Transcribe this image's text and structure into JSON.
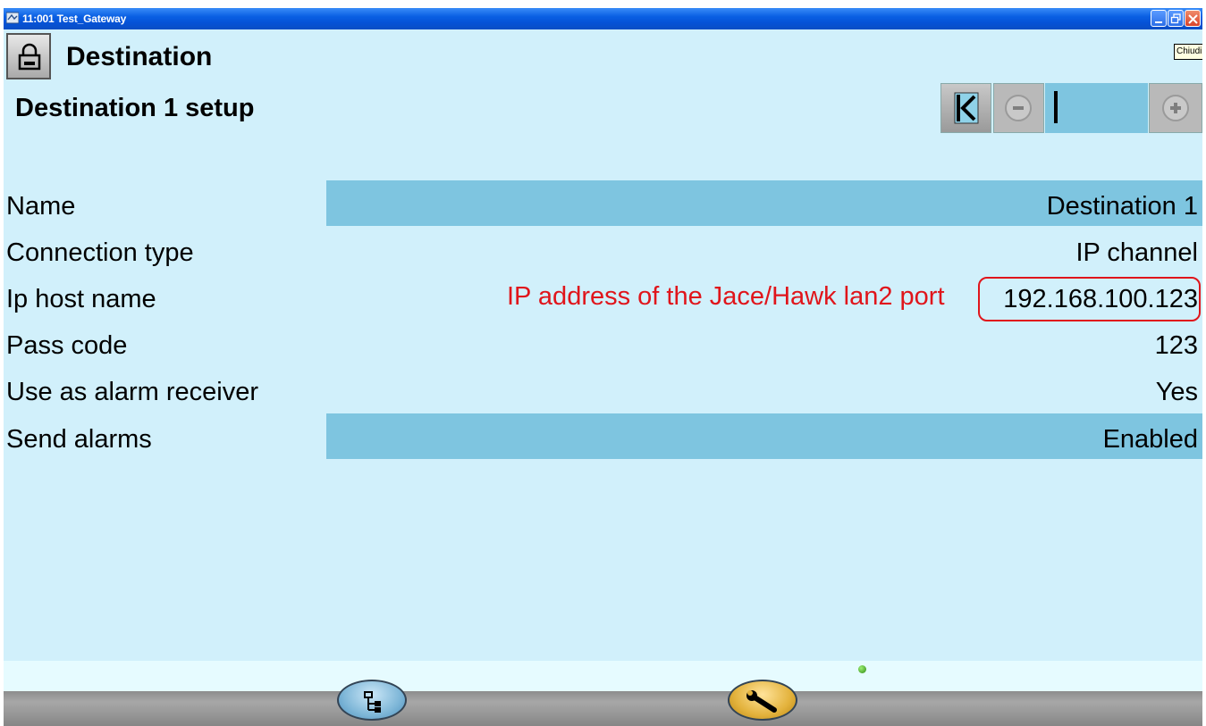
{
  "window": {
    "title": "11:001 Test_Gateway",
    "tooltip": "Chiudi"
  },
  "header": {
    "title": "Destination",
    "subtitle": "Destination 1 setup"
  },
  "rows": [
    {
      "label": "Name",
      "value": "Destination 1"
    },
    {
      "label": "Connection type",
      "value": "IP channel"
    },
    {
      "label": "Ip host name",
      "value": "192.168.100.123"
    },
    {
      "label": "Pass code",
      "value": "123"
    },
    {
      "label": "Use as alarm receiver",
      "value": "Yes"
    },
    {
      "label": "Send alarms",
      "value": "Enabled"
    }
  ],
  "annotation": "IP address of the Jace/Hawk lan2 port",
  "icons": {
    "lock": "lock-icon",
    "first": "first-page-icon",
    "prev": "minus-icon",
    "next": "plus-icon",
    "tree": "tree-view-icon",
    "tools": "wrench-icon",
    "status": "status-dot-icon"
  },
  "colors": {
    "background": "#d1f0fb",
    "highlight_row": "#7ec5e0",
    "annotation": "#e0151b",
    "titlebar": "#0a5fe3"
  }
}
